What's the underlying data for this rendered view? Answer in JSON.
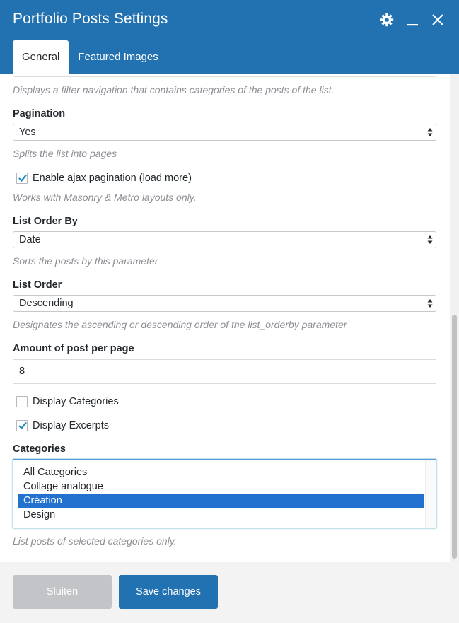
{
  "header": {
    "title": "Portfolio Posts Settings",
    "icons": [
      "gear-icon",
      "minimize-icon",
      "close-icon"
    ],
    "color": "#2271b1"
  },
  "tabs": [
    {
      "label": "General",
      "active": true
    },
    {
      "label": "Featured Images",
      "active": false
    }
  ],
  "form": {
    "filter_desc": "Displays a filter navigation that contains categories of the posts of the list.",
    "pagination": {
      "label": "Pagination",
      "value": "Yes",
      "desc": "Splits the list into pages"
    },
    "ajax": {
      "label": "Enable ajax pagination (load more)",
      "checked": true,
      "desc": "Works with Masonry & Metro layouts only."
    },
    "order_by": {
      "label": "List Order By",
      "value": "Date",
      "desc": "Sorts the posts by this parameter"
    },
    "order": {
      "label": "List Order",
      "value": "Descending",
      "desc": "Designates the ascending or descending order of the list_orderby parameter"
    },
    "amount": {
      "label": "Amount of post per page",
      "value": "8"
    },
    "display_categories": {
      "label": "Display Categories",
      "checked": false
    },
    "display_excerpts": {
      "label": "Display Excerpts",
      "checked": true
    },
    "categories": {
      "label": "Categories",
      "options": [
        "All Categories",
        "Collage analogue",
        "Création",
        "Design"
      ],
      "selected": "Création",
      "desc": "List posts of selected categories only."
    }
  },
  "footer": {
    "close_label": "Sluiten",
    "save_label": "Save changes"
  }
}
